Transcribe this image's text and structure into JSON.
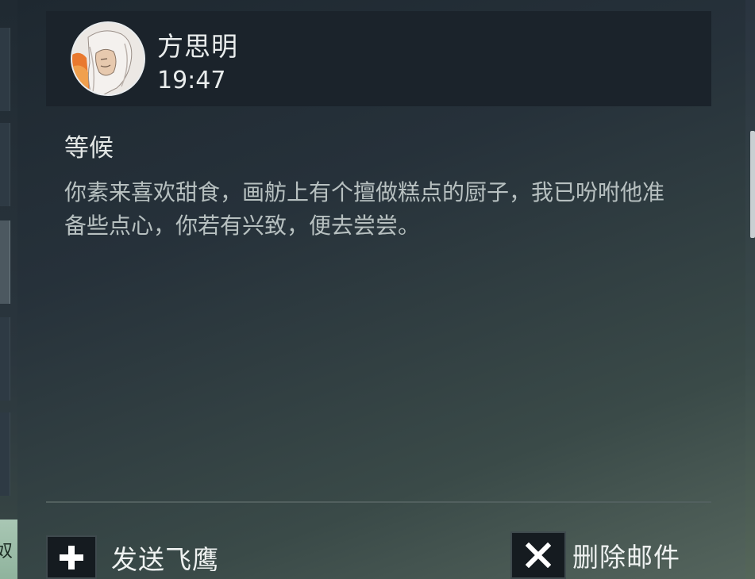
{
  "mail": {
    "sender_name": "方思明",
    "time": "19:47",
    "subject": "等候",
    "body": "你素来喜欢甜食，画舫上有个擅做糕点的厨子，我已吩咐他准备些点心，你若有兴致，便去尝尝。"
  },
  "actions": {
    "send_label": "发送飞鹰",
    "delete_label": "删除邮件"
  },
  "left_panel": {
    "partial_text": "奴"
  },
  "icons": {
    "send": "plus-icon",
    "delete": "close-icon"
  }
}
